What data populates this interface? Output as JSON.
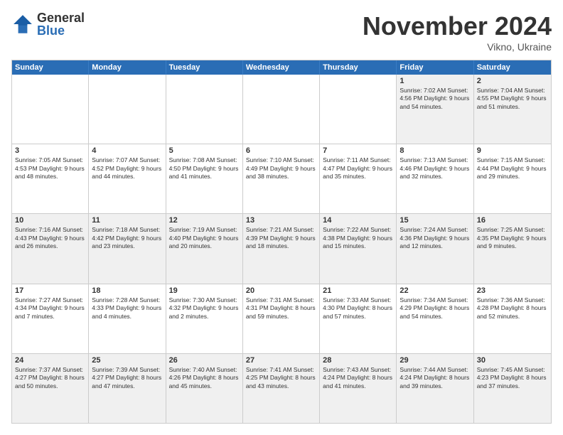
{
  "logo": {
    "general": "General",
    "blue": "Blue"
  },
  "header": {
    "month": "November 2024",
    "location": "Vikno, Ukraine"
  },
  "weekdays": [
    "Sunday",
    "Monday",
    "Tuesday",
    "Wednesday",
    "Thursday",
    "Friday",
    "Saturday"
  ],
  "rows": [
    [
      {
        "day": "",
        "info": ""
      },
      {
        "day": "",
        "info": ""
      },
      {
        "day": "",
        "info": ""
      },
      {
        "day": "",
        "info": ""
      },
      {
        "day": "",
        "info": ""
      },
      {
        "day": "1",
        "info": "Sunrise: 7:02 AM\nSunset: 4:56 PM\nDaylight: 9 hours and 54 minutes."
      },
      {
        "day": "2",
        "info": "Sunrise: 7:04 AM\nSunset: 4:55 PM\nDaylight: 9 hours and 51 minutes."
      }
    ],
    [
      {
        "day": "3",
        "info": "Sunrise: 7:05 AM\nSunset: 4:53 PM\nDaylight: 9 hours and 48 minutes."
      },
      {
        "day": "4",
        "info": "Sunrise: 7:07 AM\nSunset: 4:52 PM\nDaylight: 9 hours and 44 minutes."
      },
      {
        "day": "5",
        "info": "Sunrise: 7:08 AM\nSunset: 4:50 PM\nDaylight: 9 hours and 41 minutes."
      },
      {
        "day": "6",
        "info": "Sunrise: 7:10 AM\nSunset: 4:49 PM\nDaylight: 9 hours and 38 minutes."
      },
      {
        "day": "7",
        "info": "Sunrise: 7:11 AM\nSunset: 4:47 PM\nDaylight: 9 hours and 35 minutes."
      },
      {
        "day": "8",
        "info": "Sunrise: 7:13 AM\nSunset: 4:46 PM\nDaylight: 9 hours and 32 minutes."
      },
      {
        "day": "9",
        "info": "Sunrise: 7:15 AM\nSunset: 4:44 PM\nDaylight: 9 hours and 29 minutes."
      }
    ],
    [
      {
        "day": "10",
        "info": "Sunrise: 7:16 AM\nSunset: 4:43 PM\nDaylight: 9 hours and 26 minutes."
      },
      {
        "day": "11",
        "info": "Sunrise: 7:18 AM\nSunset: 4:42 PM\nDaylight: 9 hours and 23 minutes."
      },
      {
        "day": "12",
        "info": "Sunrise: 7:19 AM\nSunset: 4:40 PM\nDaylight: 9 hours and 20 minutes."
      },
      {
        "day": "13",
        "info": "Sunrise: 7:21 AM\nSunset: 4:39 PM\nDaylight: 9 hours and 18 minutes."
      },
      {
        "day": "14",
        "info": "Sunrise: 7:22 AM\nSunset: 4:38 PM\nDaylight: 9 hours and 15 minutes."
      },
      {
        "day": "15",
        "info": "Sunrise: 7:24 AM\nSunset: 4:36 PM\nDaylight: 9 hours and 12 minutes."
      },
      {
        "day": "16",
        "info": "Sunrise: 7:25 AM\nSunset: 4:35 PM\nDaylight: 9 hours and 9 minutes."
      }
    ],
    [
      {
        "day": "17",
        "info": "Sunrise: 7:27 AM\nSunset: 4:34 PM\nDaylight: 9 hours and 7 minutes."
      },
      {
        "day": "18",
        "info": "Sunrise: 7:28 AM\nSunset: 4:33 PM\nDaylight: 9 hours and 4 minutes."
      },
      {
        "day": "19",
        "info": "Sunrise: 7:30 AM\nSunset: 4:32 PM\nDaylight: 9 hours and 2 minutes."
      },
      {
        "day": "20",
        "info": "Sunrise: 7:31 AM\nSunset: 4:31 PM\nDaylight: 8 hours and 59 minutes."
      },
      {
        "day": "21",
        "info": "Sunrise: 7:33 AM\nSunset: 4:30 PM\nDaylight: 8 hours and 57 minutes."
      },
      {
        "day": "22",
        "info": "Sunrise: 7:34 AM\nSunset: 4:29 PM\nDaylight: 8 hours and 54 minutes."
      },
      {
        "day": "23",
        "info": "Sunrise: 7:36 AM\nSunset: 4:28 PM\nDaylight: 8 hours and 52 minutes."
      }
    ],
    [
      {
        "day": "24",
        "info": "Sunrise: 7:37 AM\nSunset: 4:27 PM\nDaylight: 8 hours and 50 minutes."
      },
      {
        "day": "25",
        "info": "Sunrise: 7:39 AM\nSunset: 4:27 PM\nDaylight: 8 hours and 47 minutes."
      },
      {
        "day": "26",
        "info": "Sunrise: 7:40 AM\nSunset: 4:26 PM\nDaylight: 8 hours and 45 minutes."
      },
      {
        "day": "27",
        "info": "Sunrise: 7:41 AM\nSunset: 4:25 PM\nDaylight: 8 hours and 43 minutes."
      },
      {
        "day": "28",
        "info": "Sunrise: 7:43 AM\nSunset: 4:24 PM\nDaylight: 8 hours and 41 minutes."
      },
      {
        "day": "29",
        "info": "Sunrise: 7:44 AM\nSunset: 4:24 PM\nDaylight: 8 hours and 39 minutes."
      },
      {
        "day": "30",
        "info": "Sunrise: 7:45 AM\nSunset: 4:23 PM\nDaylight: 8 hours and 37 minutes."
      }
    ]
  ]
}
